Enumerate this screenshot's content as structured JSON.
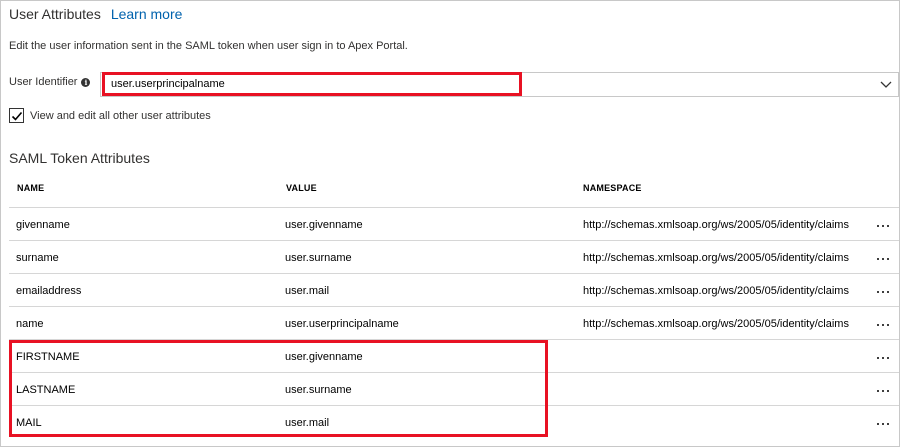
{
  "header": {
    "title": "User Attributes",
    "learn_more": "Learn more"
  },
  "description": "Edit the user information sent in the SAML token when user sign in to Apex Portal.",
  "identifier": {
    "label": "User Identifier",
    "value": "user.userprincipalname"
  },
  "checkbox": {
    "label": "View and edit all other user attributes",
    "checked": true
  },
  "section_title": "SAML Token Attributes",
  "table": {
    "columns": [
      "NAME",
      "VALUE",
      "NAMESPACE"
    ],
    "rows": [
      {
        "name": "givenname",
        "value": "user.givenname",
        "namespace": "http://schemas.xmlsoap.org/ws/2005/05/identity/claims"
      },
      {
        "name": "surname",
        "value": "user.surname",
        "namespace": "http://schemas.xmlsoap.org/ws/2005/05/identity/claims"
      },
      {
        "name": "emailaddress",
        "value": "user.mail",
        "namespace": "http://schemas.xmlsoap.org/ws/2005/05/identity/claims"
      },
      {
        "name": "name",
        "value": "user.userprincipalname",
        "namespace": "http://schemas.xmlsoap.org/ws/2005/05/identity/claims"
      },
      {
        "name": "FIRSTNAME",
        "value": "user.givenname",
        "namespace": ""
      },
      {
        "name": "LASTNAME",
        "value": "user.surname",
        "namespace": ""
      },
      {
        "name": "MAIL",
        "value": "user.mail",
        "namespace": ""
      }
    ]
  },
  "colors": {
    "link": "#0062ad",
    "highlight": "#e81123",
    "border": "#c8c8c8"
  },
  "icons": [
    "info-icon",
    "chevron-down-icon",
    "checkmark-icon",
    "more-icon"
  ]
}
